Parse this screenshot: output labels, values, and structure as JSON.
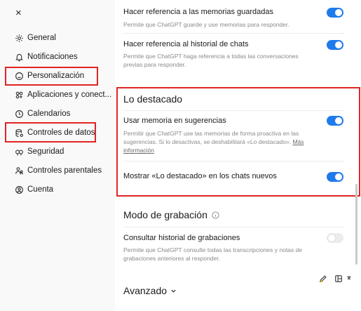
{
  "sidebar": {
    "close_label": "×",
    "items": [
      {
        "label": "General",
        "icon": "gear-icon"
      },
      {
        "label": "Notificaciones",
        "icon": "bell-icon"
      },
      {
        "label": "Personalización",
        "icon": "personalization-icon"
      },
      {
        "label": "Aplicaciones y conect...",
        "icon": "apps-icon"
      },
      {
        "label": "Calendarios",
        "icon": "clock-icon"
      },
      {
        "label": "Controles de datos",
        "icon": "database-icon"
      },
      {
        "label": "Seguridad",
        "icon": "shield-key-icon"
      },
      {
        "label": "Controles parentales",
        "icon": "family-icon"
      },
      {
        "label": "Cuenta",
        "icon": "account-icon"
      }
    ]
  },
  "main": {
    "rows_top": [
      {
        "title": "Hacer referencia a las memorias guardadas",
        "desc": "Permite que ChatGPT guarde y use memorias para responder.",
        "enabled": true
      },
      {
        "title": "Hacer referencia al historial de chats",
        "desc": "Permite que ChatGPT haga referencia a todas las conversaciones previas para responder.",
        "enabled": true
      }
    ],
    "highlights": {
      "title": "Lo destacado",
      "rows": [
        {
          "title": "Usar memoria en sugerencias",
          "desc": "Permitir que ChatGPT use las memorias de forma proactiva en las sugerencias. Si lo desactivas, se deshabilitará «Lo destacado».",
          "link": "Más información",
          "enabled": true
        },
        {
          "title": "Mostrar «Lo destacado» en los chats nuevos",
          "enabled": true
        }
      ]
    },
    "recording": {
      "title": "Modo de grabación",
      "info_icon": "info-icon",
      "rows": [
        {
          "title": "Consultar historial de grabaciones",
          "desc": "Permite que ChatGPT consulte todas las transcripciones y notas de grabaciones anteriores al responder.",
          "enabled": false
        }
      ]
    },
    "advanced": {
      "title": "Avanzado",
      "icon": "chevron-down-icon"
    }
  },
  "colors": {
    "accent": "#1f7aec",
    "highlight_border": "#e02424"
  }
}
